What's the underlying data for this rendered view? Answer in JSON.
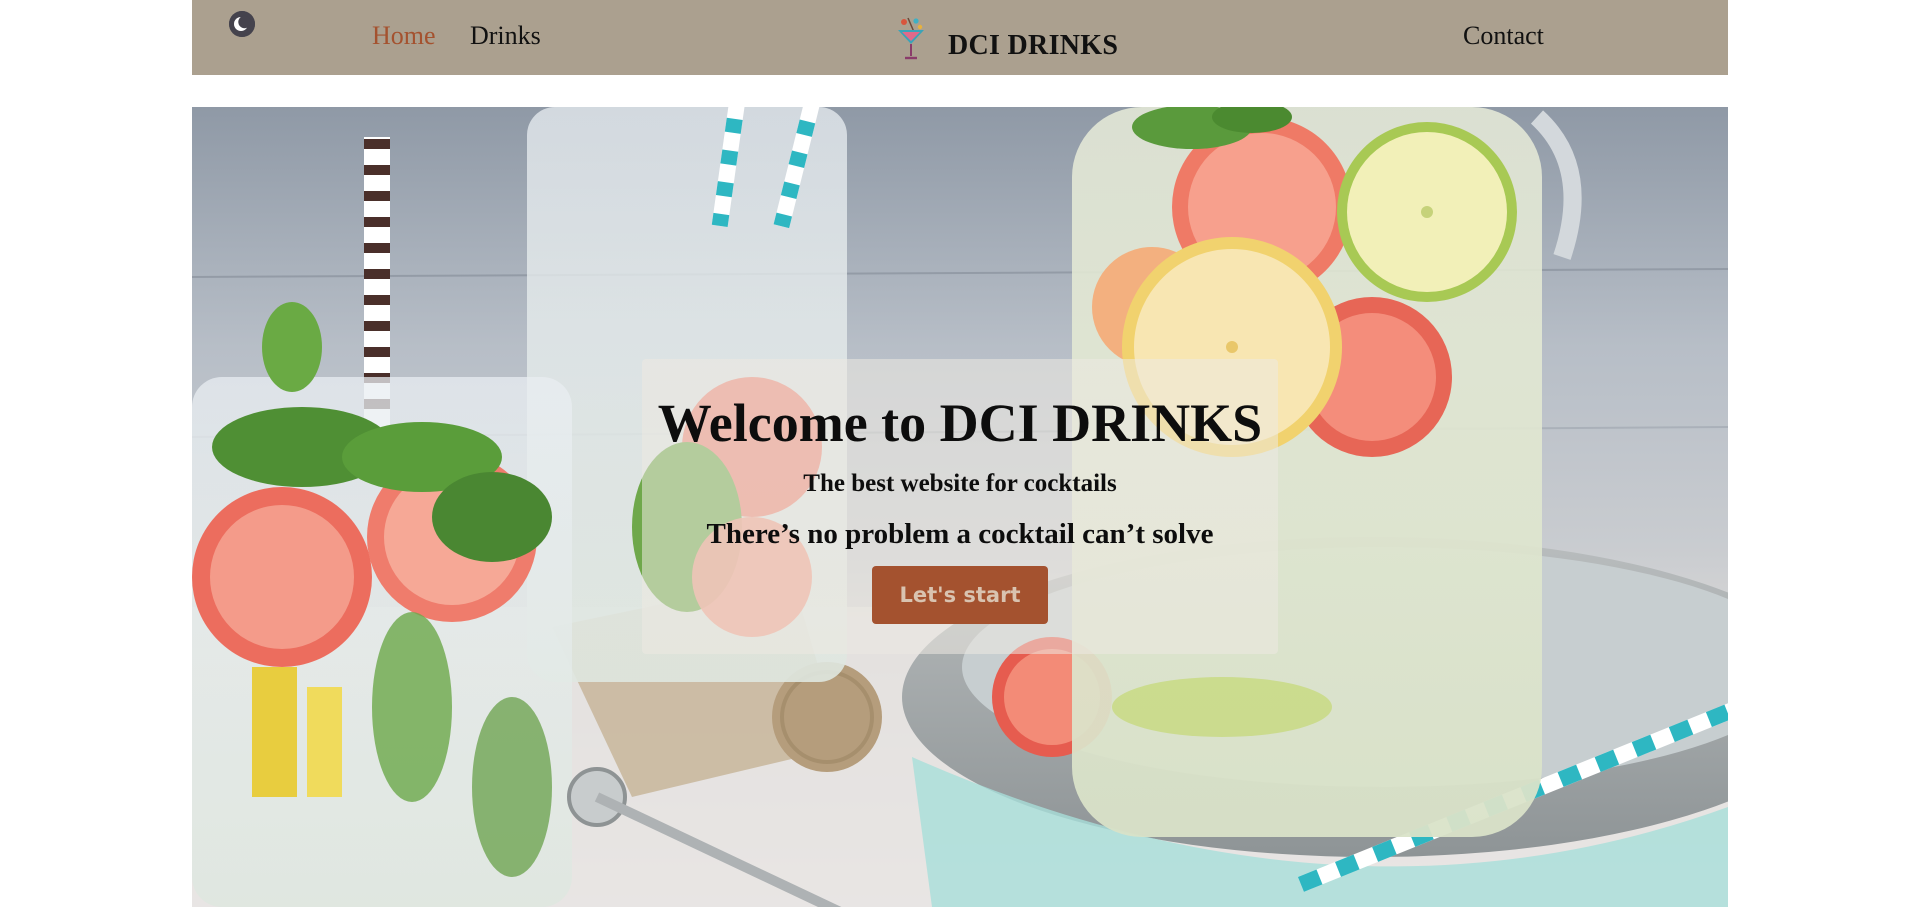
{
  "navbar": {
    "theme_toggle_icon": "moon-icon",
    "links": {
      "home": "Home",
      "drinks": "Drinks",
      "contact": "Contact"
    },
    "active_link": "home",
    "brand": {
      "name": "DCI DRINKS",
      "logo_icon": "cocktail-glass-icon"
    }
  },
  "hero": {
    "title": "Welcome to DCI DRINKS",
    "subtitle": "The best website for cocktails",
    "tagline": "There’s no problem a cocktail can’t solve",
    "cta_label": "Let's start"
  },
  "colors": {
    "navbar_bg": "#aba08f",
    "accent": "#a4522f",
    "button_text": "#d9c3b0",
    "toggle_bg": "#45434d"
  }
}
